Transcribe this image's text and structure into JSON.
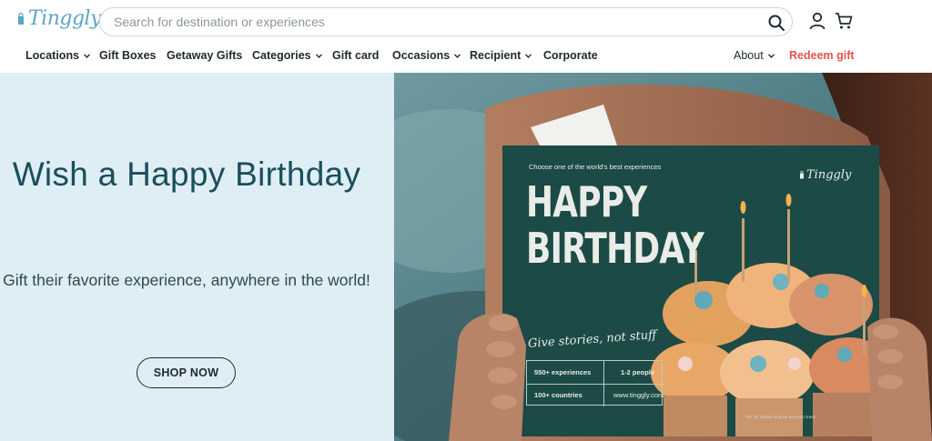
{
  "header": {
    "logo_text": "Tinggly",
    "search_placeholder": "Search for destination or experiences",
    "icons": {
      "search": "search-icon",
      "user": "user-icon",
      "cart": "cart-icon"
    }
  },
  "nav": {
    "locations": "Locations",
    "gift_boxes": "Gift Boxes",
    "getaway_gifts": "Getaway Gifts",
    "categories": "Categories",
    "gift_card": "Gift card",
    "occasions": "Occasions",
    "recipient": "Recipient",
    "corporate": "Corporate",
    "about": "About",
    "redeem": "Redeem gift"
  },
  "hero": {
    "title": "Wish a Happy Birthday",
    "subtitle": "Gift their favorite experience, anywhere in the world!",
    "cta": "SHOP NOW"
  },
  "card": {
    "tag": "Choose one of the world's best experiences",
    "logo_text": "Tinggly",
    "title": "HAPPY BIRTHDAY",
    "tagline": "Give stories, not stuff",
    "stat_experiences": "550+ experiences",
    "stat_people": "1-2 people",
    "stat_countries": "100+ countries",
    "stat_site": "www.tinggly.com",
    "footnote": "This gift helped us plant & protect trees"
  },
  "colors": {
    "brand": "#5aa7c8",
    "hero_bg": "#dfeef4",
    "hero_title": "#1b4e5c",
    "redeem": "#e5534b",
    "card_green": "#1c4a47"
  }
}
